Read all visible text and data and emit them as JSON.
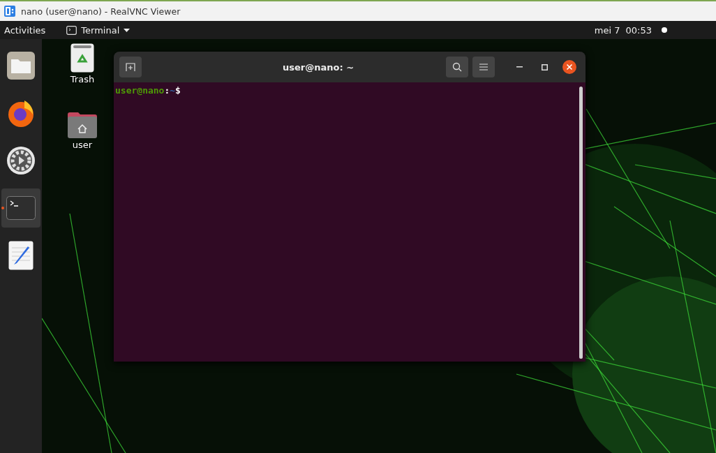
{
  "viewer_window": {
    "title": "nano (user@nano) - RealVNC Viewer"
  },
  "top_bar": {
    "activities": "Activities",
    "app_menu": "Terminal",
    "date": "mei 7",
    "time": "00:53"
  },
  "dock": {
    "items": [
      {
        "kind": "files",
        "selected": false,
        "running": false
      },
      {
        "kind": "browser",
        "selected": false,
        "running": false
      },
      {
        "kind": "settings",
        "selected": false,
        "running": false
      },
      {
        "kind": "terminal",
        "selected": true,
        "running": true
      },
      {
        "kind": "editor",
        "selected": false,
        "running": false
      }
    ]
  },
  "desktop_icons": [
    {
      "kind": "trash",
      "label": "Trash"
    },
    {
      "kind": "home",
      "label": "user"
    }
  ],
  "terminal": {
    "title": "user@nano: ~",
    "prompt": {
      "user_host": "user@nano",
      "separator": ":",
      "path": "~",
      "symbol": "$"
    }
  }
}
